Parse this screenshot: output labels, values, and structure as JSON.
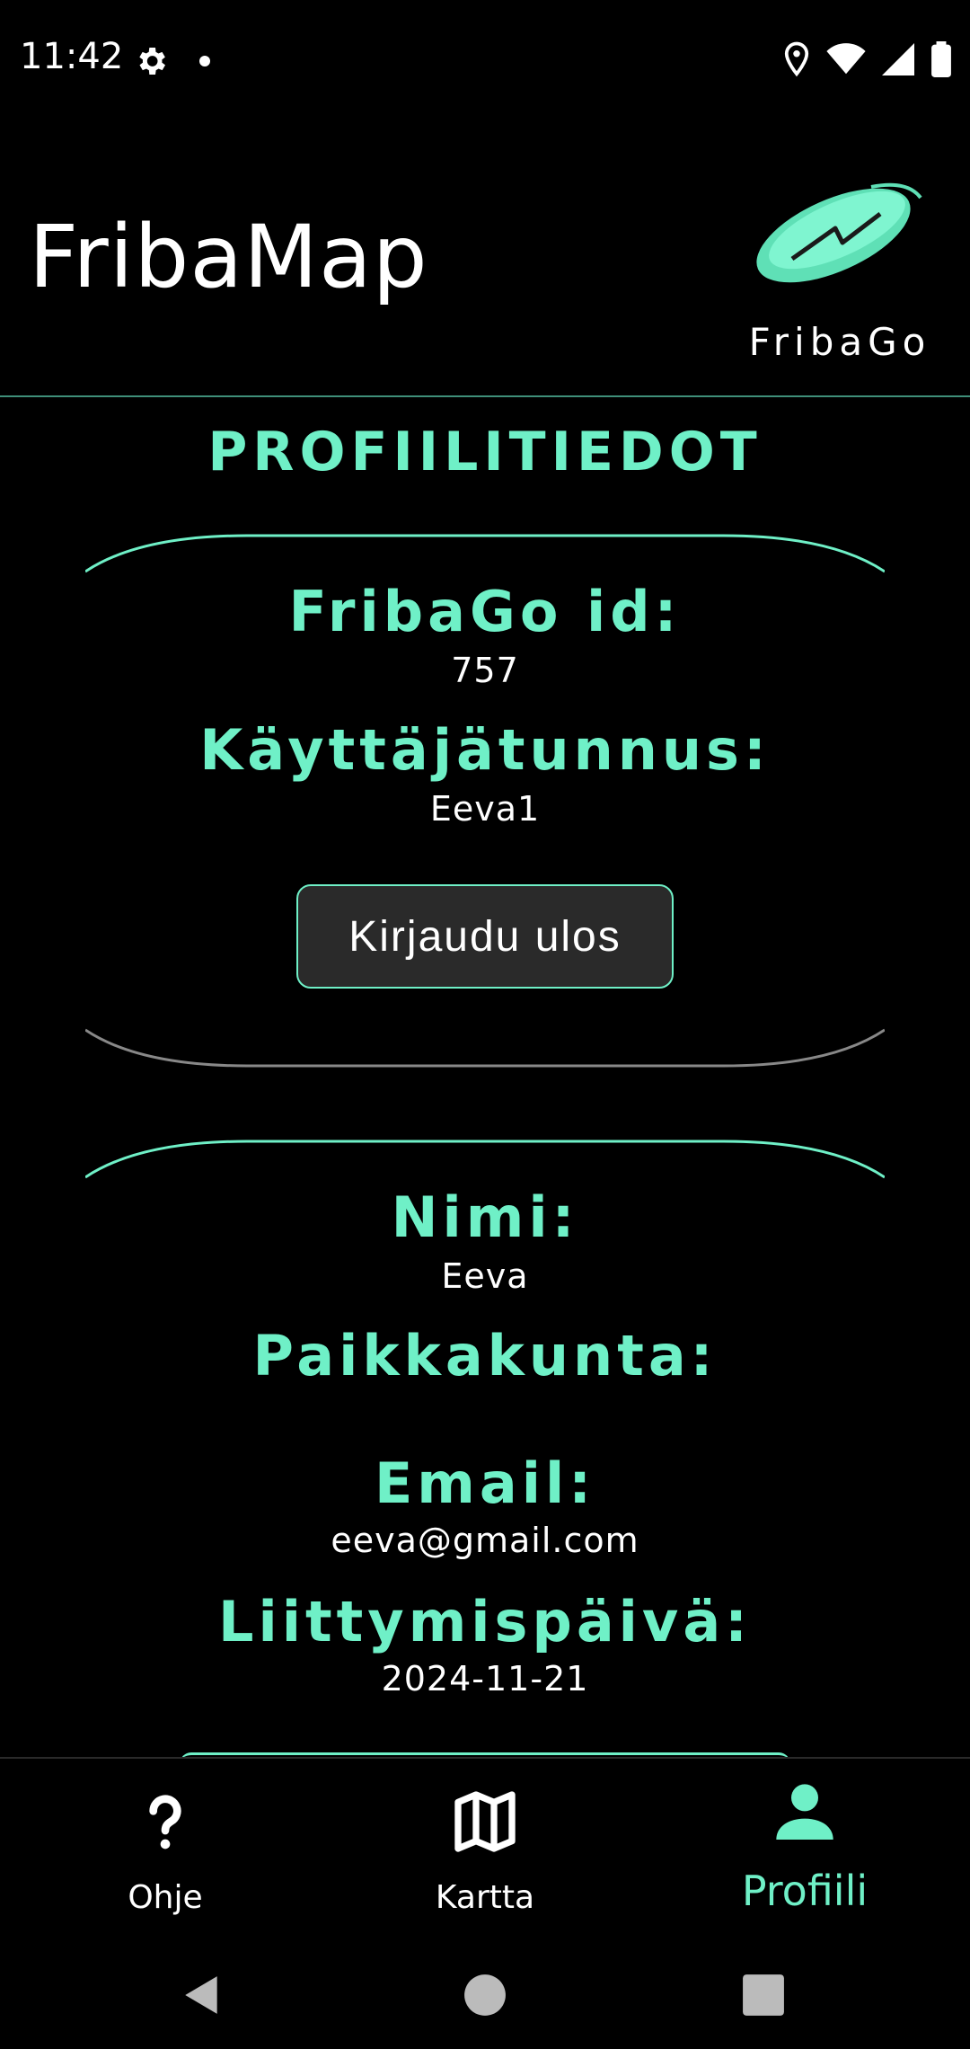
{
  "status_bar": {
    "time": "11:42"
  },
  "app_bar": {
    "title": "FribaMap",
    "logo_text": "FribaGo"
  },
  "section_title": "PROFIILITIEDOT",
  "account_card": {
    "id_label": "FribaGo id:",
    "id_value": "757",
    "username_label": "Käyttäjätunnus:",
    "username_value": "Eeva1",
    "logout_label": "Kirjaudu ulos"
  },
  "profile_card": {
    "name_label": "Nimi:",
    "name_value": "Eeva",
    "city_label": "Paikkakunta:",
    "city_value": "",
    "email_label": "Email:",
    "email_value": "eeva@gmail.com",
    "joined_label": "Liittymispäivä:",
    "joined_value": "2024-11-21"
  },
  "bottom_nav": {
    "items": [
      {
        "label": "Ohje",
        "icon": "help-icon",
        "active": false
      },
      {
        "label": "Kartta",
        "icon": "map-icon",
        "active": false
      },
      {
        "label": "Profiili",
        "icon": "person-icon",
        "active": true
      }
    ]
  },
  "colors": {
    "accent": "#6ff0c7",
    "background": "#000000",
    "button": "#2a2a2a"
  }
}
